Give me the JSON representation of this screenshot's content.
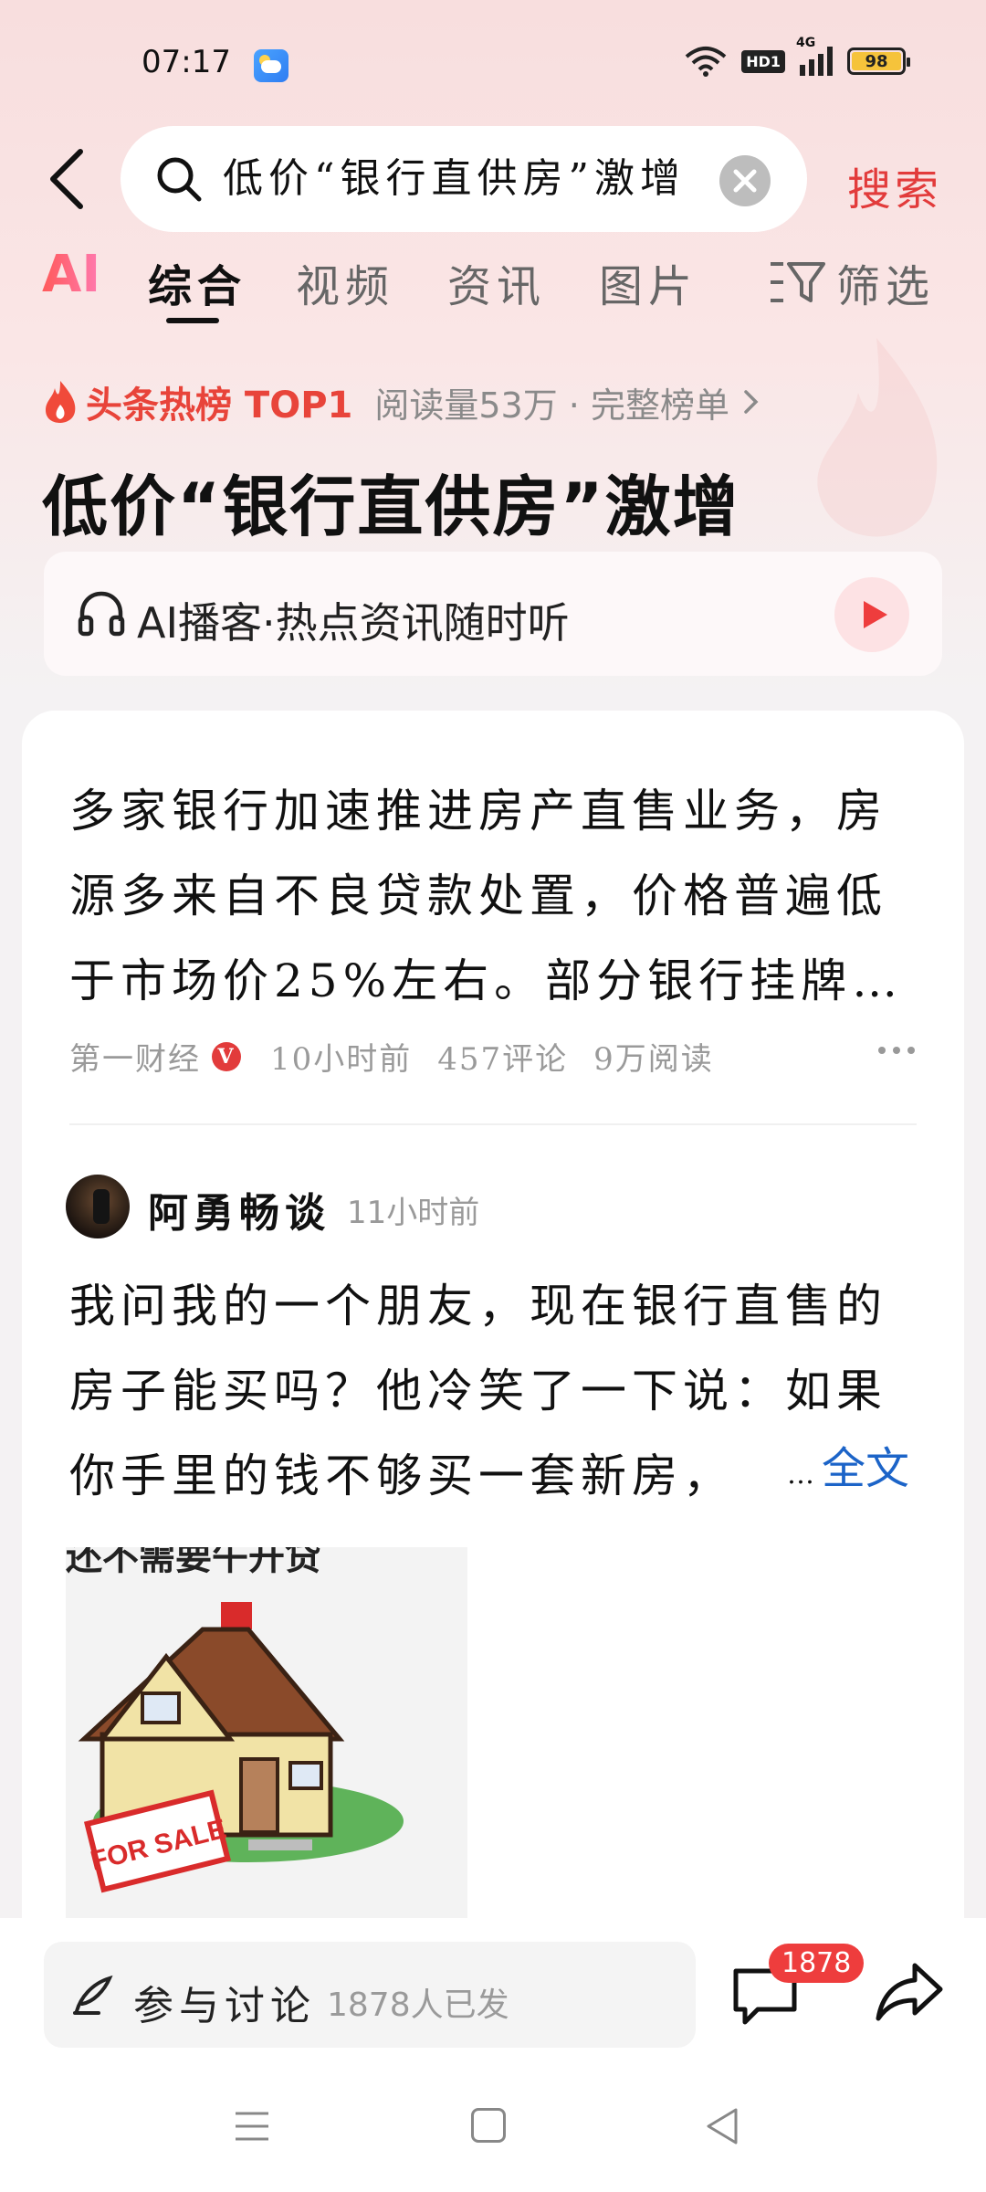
{
  "status_bar": {
    "time": "07:17",
    "network_hd": "HD1",
    "network_type": "4G",
    "battery": "98"
  },
  "search": {
    "query": "低价“银行直供房”激增",
    "submit_label": "搜索"
  },
  "tabs": {
    "ai": "AI",
    "items": [
      "综合",
      "视频",
      "资讯",
      "图片"
    ],
    "active": "综合",
    "filter_label": "筛选"
  },
  "hot": {
    "label": "头条热榜 TOP1",
    "stats": "阅读量53万 · 完整榜单",
    "headline": "低价“银行直供房”激增"
  },
  "podcast": {
    "label": "AI播客·热点资讯随时听"
  },
  "news": {
    "summary": "多家银行加速推进房产直售业务，房源多来自不良贷款处置，价格普遍低于市场价25%左右。部分银行挂牌房源数量激增",
    "source": "第一财经",
    "verified": "V",
    "time": "10小时前",
    "comments": "457评论",
    "reads": "9万阅读"
  },
  "post": {
    "author": "阿勇畅谈",
    "time": "11小时前",
    "lines": [
      "我问我的一个朋友，现在银行直售的",
      "房子能买吗？他冷笑了一下说：如果",
      "你手里的钱不够买一套新房，"
    ],
    "read_more": "全文",
    "image_caption": "还不需要午开贷",
    "image_sign": "FOR SALE"
  },
  "bottom": {
    "discuss_label": "参与讨论",
    "discuss_count": "1878人已发",
    "comment_badge": "1878"
  },
  "colors": {
    "accent": "#e23b3b",
    "link": "#1c64c8",
    "badge": "#ee3d3d"
  }
}
